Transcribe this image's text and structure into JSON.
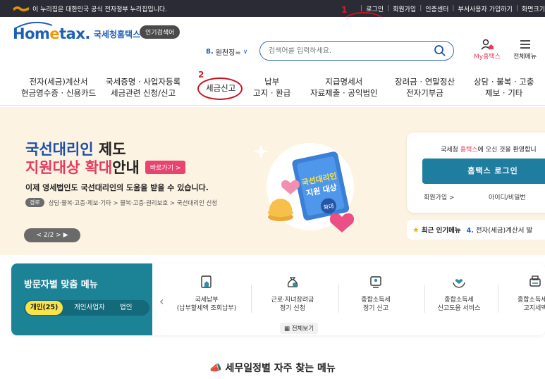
{
  "gov_bar": {
    "notice": "이 누리집은 대한민국 공식 전자정부 누리집입니다.",
    "links": [
      "로그인",
      "회원가입",
      "인증센터",
      "부서사용자 가입하기",
      "화면크기"
    ]
  },
  "header": {
    "logo_main_1": "Hom",
    "logo_main_e": "e",
    "logo_main_2": "tax.",
    "logo_sub": "국세청홈택스",
    "popular_badge": "인기검색어",
    "popular_num": "8.",
    "popular_term": "원천징=",
    "search_placeholder": "검색어를 입력하세요.",
    "my_hometax": "My홈택스",
    "all_menu": "전체메뉴"
  },
  "gnb": [
    {
      "line1": "전자(세금)계산서",
      "line2": "현금영수증 · 신용카드"
    },
    {
      "line1": "국세증명 · 사업자등록",
      "line2": "세금관련 신청/신고"
    },
    {
      "line1": "세금신고",
      "line2": ""
    },
    {
      "line1": "납부",
      "line2": "고지 · 환급"
    },
    {
      "line1": "지급명세서",
      "line2": "자료제출 · 공익법인"
    },
    {
      "line1": "장려금 · 연말정산",
      "line2": "전자기부금"
    },
    {
      "line1": "상담 · 불복 · 고충",
      "line2": "제보 · 기타"
    }
  ],
  "annotations": {
    "one": "1",
    "two": "2"
  },
  "hero": {
    "title1_hl": "국선대리인",
    "title1_rest": " 제도",
    "title2_hl": "지원대상 확대",
    "title2_rest": " 안내",
    "go_button": "바로가기 >",
    "desc": "이제 영세법인도 국선대리인의 도움을 받을 수 있습니다.",
    "path_tag": "경로",
    "path": "상담·불복·고충·제보·기타 > 불복·고충·권리보호 > 국선대리인 신청",
    "pager": "< 2/2 >  ▶",
    "art_text1": "국선대리인",
    "art_text2": "지원 대상",
    "art_text3": "확대"
  },
  "login_card": {
    "welcome_pre": "국세청 ",
    "welcome_hl": "홈택스",
    "welcome_post": "에 오신 것을 환영합니",
    "login_button": "홈택스 로그인",
    "signup": "회원가입 >",
    "find": "아이디/비밀번"
  },
  "recent": {
    "label": "최근 인기메뉴",
    "num": "4.",
    "item": "전자(세금)계산서 발"
  },
  "visitor": {
    "title": "방문자별 맞춤 메뉴",
    "tabs": [
      "개인(25)",
      "개인사업자",
      "법인"
    ],
    "items": [
      {
        "line1": "국세납부",
        "line2": "(납부할세액 조회납부)"
      },
      {
        "line1": "근로·자녀장려금",
        "line2": "정기 신청"
      },
      {
        "line1": "종합소득세",
        "line2": "정기 신고"
      },
      {
        "line1": "종합소득세",
        "line2": "신고도움 서비스"
      },
      {
        "line1": "종합소득세 4",
        "line2": "고지세액"
      }
    ],
    "see_all": "전체보기"
  },
  "section": {
    "title": "세무일정별 자주 찾는 메뉴"
  }
}
